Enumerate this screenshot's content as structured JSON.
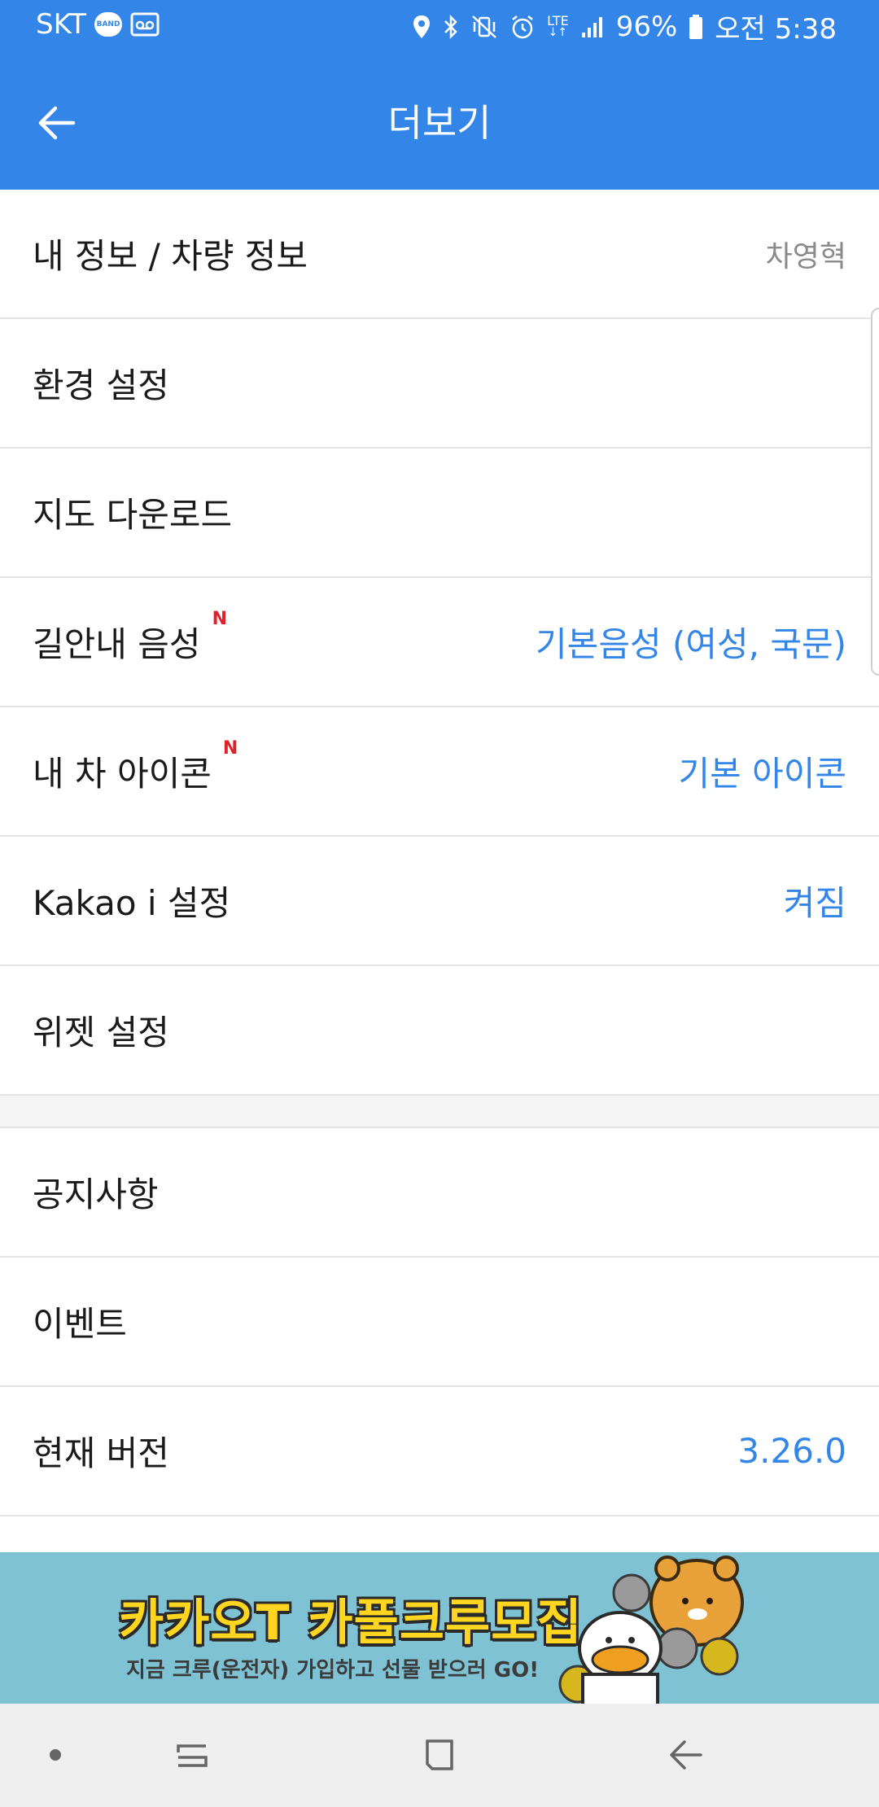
{
  "status_bar": {
    "carrier": "SKT",
    "band_badge": "BAND",
    "network": "LTE",
    "battery": "96%",
    "time": "오전 5:38",
    "icons": [
      "band-icon",
      "voicemail-icon",
      "location-icon",
      "bluetooth-icon",
      "vibrate-icon",
      "alarm-icon",
      "lte-icon",
      "signal-icon",
      "battery-icon"
    ]
  },
  "app_bar": {
    "title": "더보기",
    "back_icon": "arrow-left-icon",
    "background": "#3386e8"
  },
  "menu": {
    "section1": [
      {
        "label": "내 정보 / 차량 정보",
        "value": "차영혁"
      },
      {
        "label": "환경 설정",
        "value": ""
      },
      {
        "label": "지도 다운로드",
        "value": ""
      },
      {
        "label": "길안내 음성",
        "badge": "N",
        "value": "기본음성 (여성, 국문)"
      },
      {
        "label": "내 차 아이콘",
        "badge": "N",
        "value": "기본 아이콘"
      },
      {
        "label": "Kakao i 설정",
        "value": "켜짐"
      },
      {
        "label": "위젯 설정",
        "value": ""
      }
    ],
    "section2": [
      {
        "label": "공지사항",
        "value": ""
      },
      {
        "label": "이벤트",
        "value": ""
      },
      {
        "label": "현재 버전",
        "value": "3.26.0"
      }
    ],
    "accent_color": "#3386e8",
    "badge_color": "#e0202b"
  },
  "banner": {
    "headline": "카카오T 카풀크루모집",
    "subtext": "지금 크루(운전자) 가입하고 선물 받으러 GO!",
    "background": "#7ec2d3"
  },
  "nav_bar": {
    "buttons": [
      "dot-icon",
      "recent-apps-icon",
      "home-icon",
      "back-icon"
    ]
  }
}
